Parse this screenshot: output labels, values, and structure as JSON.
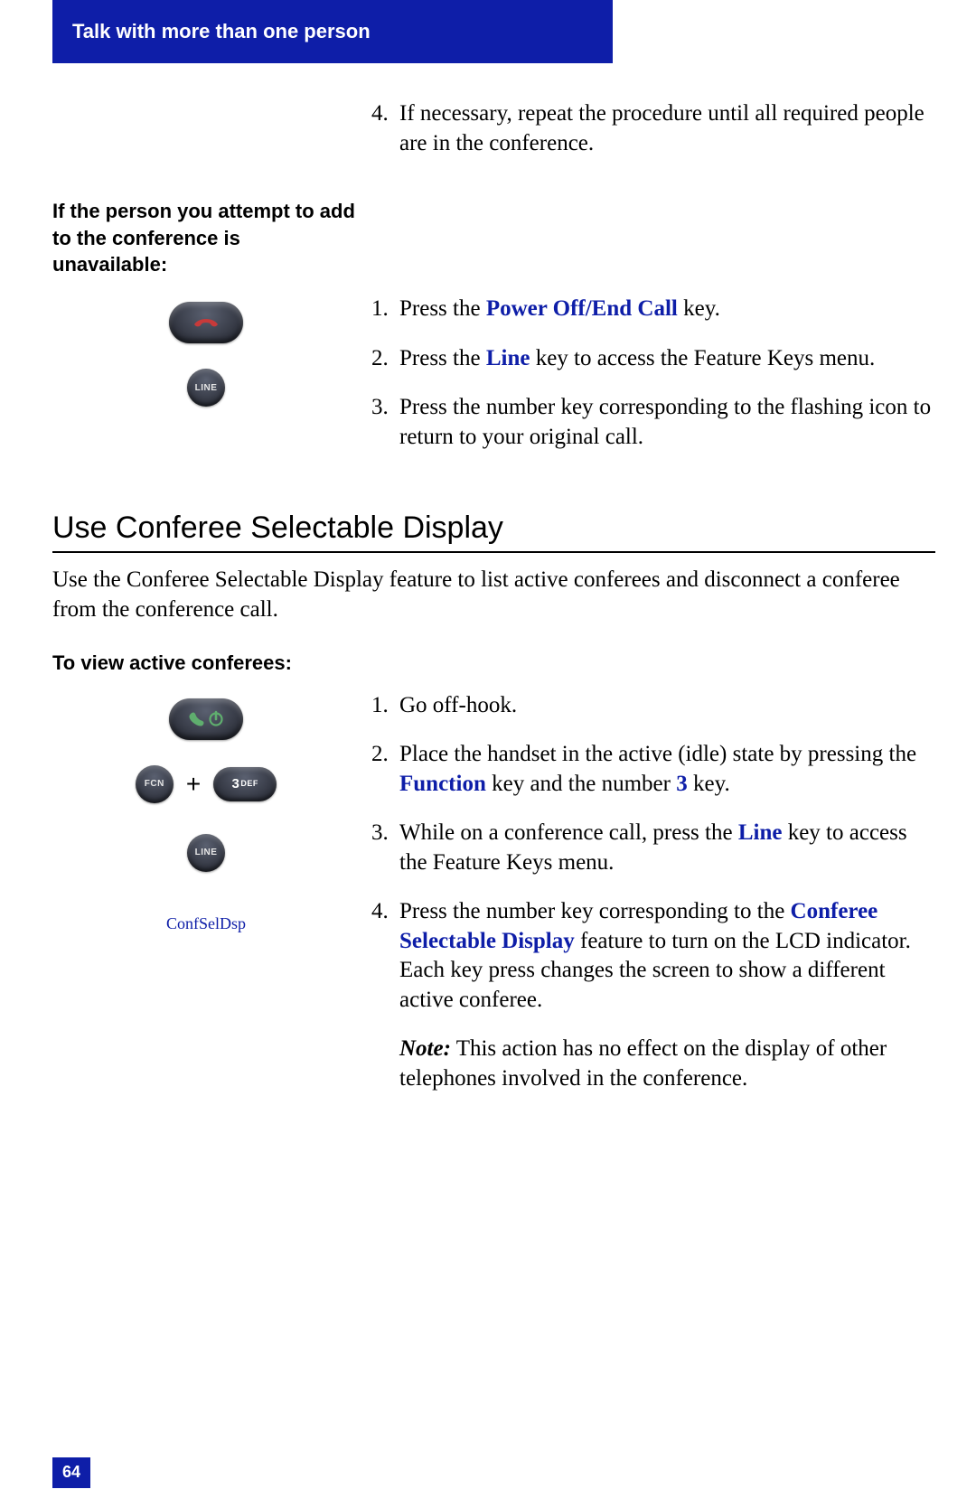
{
  "header": {
    "title": "Talk with more than one person"
  },
  "top_list": {
    "start": 4,
    "items": [
      "If necessary, repeat the procedure until all required people are in the conference."
    ]
  },
  "unavailable": {
    "heading": "If the person you attempt to add to the conference is unavailable:",
    "list": {
      "start": 1,
      "items": [
        {
          "pre": "Press the ",
          "em": "Power Off/End Call",
          "post": " key."
        },
        {
          "pre": "Press the ",
          "em": "Line",
          "post": " key to access the Feature Keys menu."
        },
        {
          "plain": "Press the number key corresponding to the flashing icon to return to your original call."
        }
      ]
    }
  },
  "section2": {
    "heading": "Use Conferee Selectable Display",
    "intro": "Use the Conferee Selectable Display feature to list active conferees and disconnect a conferee from the conference call.",
    "sub_heading": "To view active conferees:",
    "feature_label": "ConfSelDsp",
    "list": {
      "start": 1,
      "items": [
        {
          "plain": "Go off-hook."
        },
        {
          "parts": [
            "Place the handset in the active (idle) state by pressing the ",
            {
              "em": "Function"
            },
            " key and the number ",
            {
              "em": "3"
            },
            " key."
          ]
        },
        {
          "parts": [
            "While on a conference call, press the ",
            {
              "em": "Line"
            },
            " key to access the Feature Keys menu."
          ]
        },
        {
          "parts": [
            "Press the number key corresponding to the ",
            {
              "em": "Conferee Selectable Display"
            },
            " feature to turn on the LCD indicator. Each key press changes the screen to show a different active conferee."
          ]
        }
      ]
    },
    "note": {
      "label": "Note:",
      "body": " This action has no effect on the display of other telephones involved in the conference."
    }
  },
  "labels": {
    "line": "LINE",
    "fcn": "FCN",
    "key3": "3",
    "key3_sub": "DEF",
    "plus": "+"
  },
  "page_number": "64"
}
